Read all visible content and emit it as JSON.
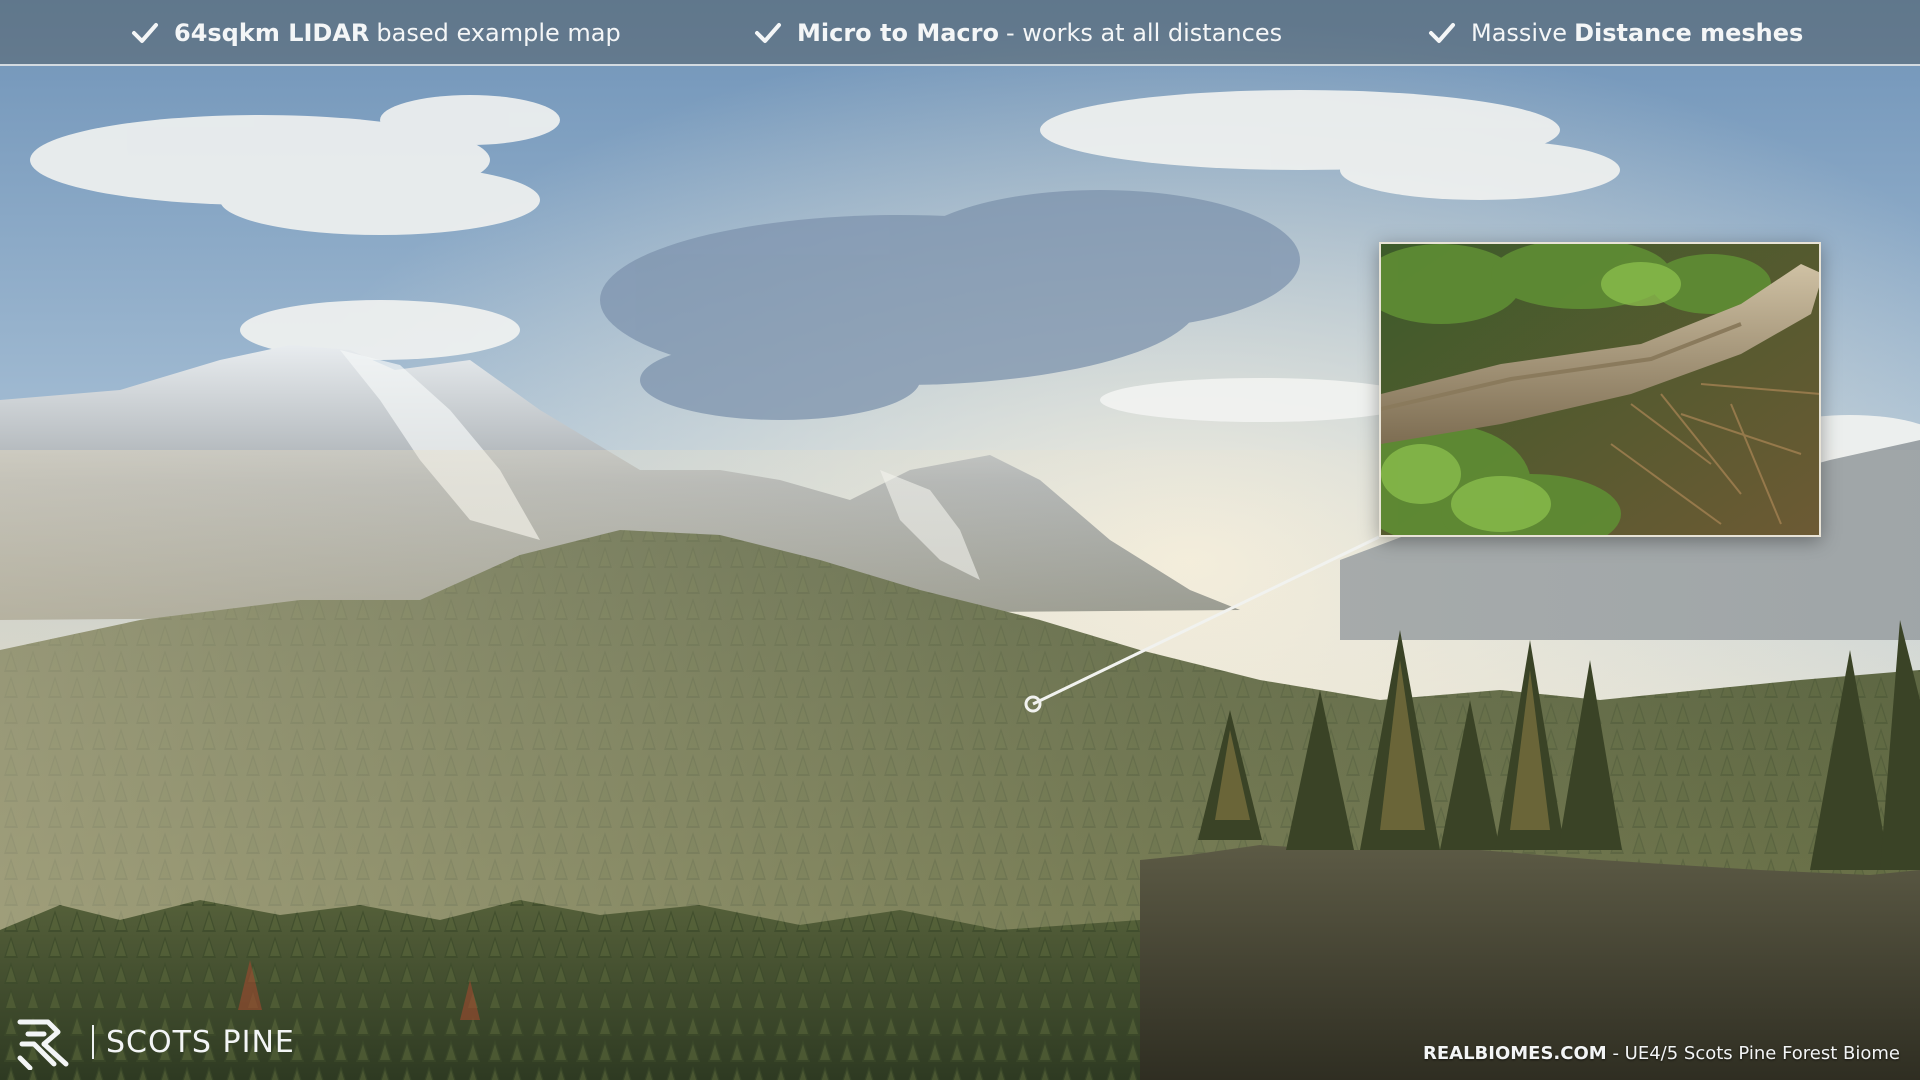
{
  "features": [
    {
      "bold_first": "64sqkm LIDAR",
      "normal_after": "based example map",
      "icon": "checkmark-icon"
    },
    {
      "bold_first": "Micro to Macro",
      "normal_after": "- works at all distances",
      "icon": "checkmark-icon"
    },
    {
      "normal_before": "Massive",
      "bold_last": "Distance meshes",
      "icon": "checkmark-icon"
    }
  ],
  "brand": {
    "name": "SCOTS PINE",
    "logo_icon": "realbiomes-logo-icon"
  },
  "footer": {
    "site": "REALBIOMES.COM",
    "separator": "-",
    "product": "UE4/5 Scots Pine Forest Biome"
  },
  "colors": {
    "sky": "#8fb2cf",
    "forest_dark": "#3a4a2c",
    "forest_light": "#7f8650",
    "mountain": "#c9ccd0",
    "accent_text": "#f4f6f7"
  }
}
